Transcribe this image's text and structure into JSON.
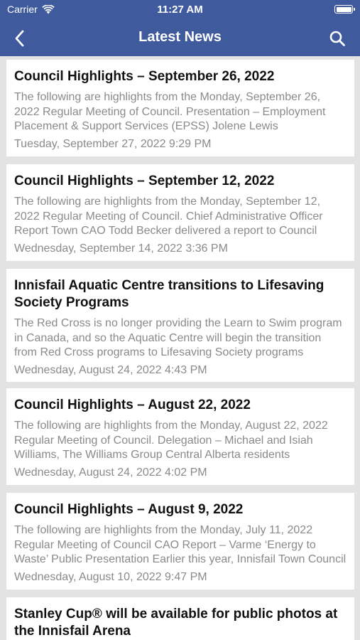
{
  "status_bar": {
    "carrier": "Carrier",
    "time": "11:27 AM",
    "battery_level": 1.0
  },
  "nav": {
    "title": "Latest News",
    "back_icon": "chevron-left-icon",
    "search_icon": "search-icon"
  },
  "colors": {
    "header_bg": "#3f5b9d",
    "list_bg": "#e3e3e3",
    "card_bg": "#ffffff",
    "meta_text": "#8a8a8a"
  },
  "news": [
    {
      "title": "Council Highlights – September 26, 2022",
      "excerpt": "The following are highlights from the Monday, September 26, 2022 Regular Meeting of Council. Presentation – Employment Placement & Support Services (EPSS) Jolene Lewis",
      "date": "Tuesday, September 27, 2022 9:29 PM"
    },
    {
      "title": "Council Highlights – September 12, 2022",
      "excerpt": "The following are highlights from the Monday, September 12, 2022 Regular Meeting of Council. Chief Administrative Officer Report Town CAO Todd Becker delivered a report to Council",
      "date": "Wednesday, September 14, 2022 3:36 PM"
    },
    {
      "title": "Innisfail Aquatic Centre transitions to Lifesaving Society Programs",
      "excerpt": "The Red Cross is no longer providing the Learn to Swim program in Canada, and so the Aquatic Centre will begin the transition from Red Cross programs to Lifesaving Society programs",
      "date": "Wednesday, August 24, 2022 4:43 PM"
    },
    {
      "title": "Council Highlights – August 22, 2022",
      "excerpt": "The following are highlights from the Monday, August 22, 2022 Regular Meeting of Council. Delegation – Michael and Isiah Williams, The Williams Group Central Alberta residents",
      "date": "Wednesday, August 24, 2022 4:02 PM"
    },
    {
      "title": "Council Highlights – August 9, 2022",
      "excerpt": "The following are highlights from the Monday, July 11, 2022 Regular Meeting of Council CAO Report – Varme ‘Energy to Waste’ Public Presentation Earlier this year, Innisfail Town Council",
      "date": "Wednesday, August 10, 2022 9:47 PM"
    },
    {
      "title": "Stanley Cup® will be available for public photos at the Innisfail Arena",
      "excerpt": "",
      "date": ""
    }
  ]
}
